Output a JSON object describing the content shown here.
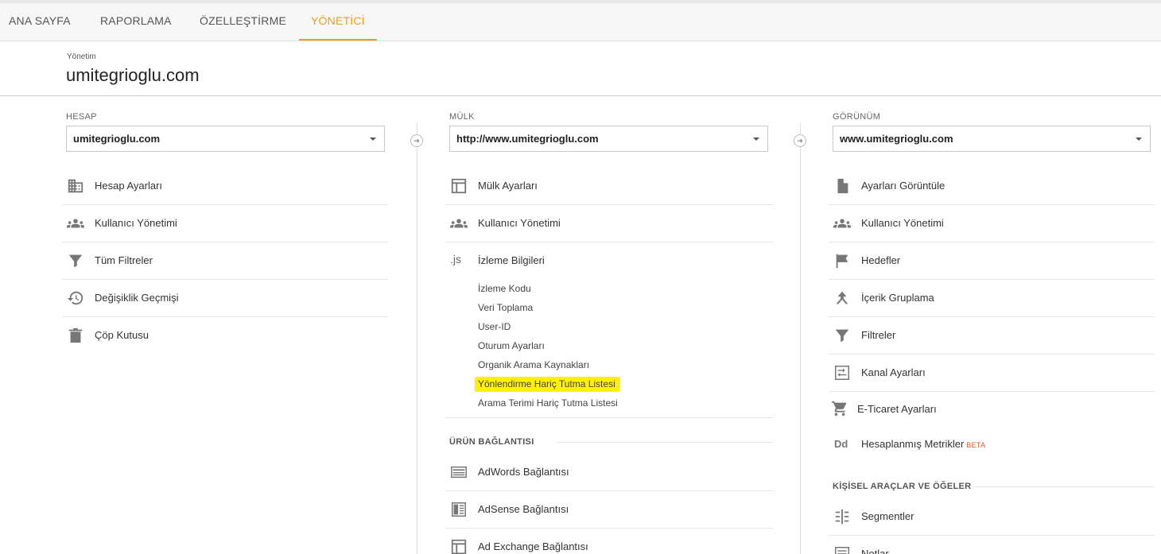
{
  "nav": {
    "tabs": [
      {
        "label": "ANA SAYFA"
      },
      {
        "label": "RAPORLAMA"
      },
      {
        "label": "ÖZELLEŞTİRME"
      },
      {
        "label": "YÖNETİCİ"
      }
    ],
    "active_color": "#f39c12"
  },
  "header": {
    "breadcrumb": "Yönetim",
    "title": "umitegrioglu.com"
  },
  "account": {
    "label": "HESAP",
    "selected": "umitegrioglu.com",
    "items": [
      {
        "label": "Hesap Ayarları",
        "icon": "building-icon"
      },
      {
        "label": "Kullanıcı Yönetimi",
        "icon": "users-icon"
      },
      {
        "label": "Tüm Filtreler",
        "icon": "filter-icon"
      },
      {
        "label": "Değişiklik Geçmişi",
        "icon": "history-icon"
      },
      {
        "label": "Çöp Kutusu",
        "icon": "trash-icon"
      }
    ]
  },
  "property": {
    "label": "MÜLK",
    "selected": "http://www.umitegrioglu.com",
    "items": [
      {
        "label": "Mülk Ayarları",
        "icon": "window-icon"
      },
      {
        "label": "Kullanıcı Yönetimi",
        "icon": "users-icon"
      },
      {
        "label": "İzleme Bilgileri",
        "icon": "js-icon",
        "icon_text": ".js"
      }
    ],
    "tracking_sub": [
      "İzleme Kodu",
      "Veri Toplama",
      "User-ID",
      "Oturum Ayarları",
      "Organik Arama Kaynakları",
      "Yönlendirme Hariç Tutma Listesi",
      "Arama Terimi Hariç Tutma Listesi"
    ],
    "highlight_color": "#fff200",
    "product_links_label": "ÜRÜN BAĞLANTISI",
    "product_links": [
      {
        "label": "AdWords Bağlantısı",
        "icon": "adwords-icon"
      },
      {
        "label": "AdSense Bağlantısı",
        "icon": "adsense-icon"
      },
      {
        "label": "Ad Exchange Bağlantısı",
        "icon": "adexchange-icon"
      }
    ]
  },
  "view": {
    "label": "GÖRÜNÜM",
    "selected": "www.umitegrioglu.com",
    "items": [
      {
        "label": "Ayarları Görüntüle",
        "icon": "document-icon"
      },
      {
        "label": "Kullanıcı Yönetimi",
        "icon": "users-icon"
      },
      {
        "label": "Hedefler",
        "icon": "flag-icon"
      },
      {
        "label": "İçerik Gruplama",
        "icon": "content-grouping-icon"
      },
      {
        "label": "Filtreler",
        "icon": "filter-icon"
      },
      {
        "label": "Kanal Ayarları",
        "icon": "channel-icon"
      },
      {
        "label": "E-Ticaret Ayarları",
        "icon": "cart-icon"
      },
      {
        "label": "Hesaplanmış Metrikler",
        "icon": "dd-icon",
        "icon_text": "Dd",
        "badge": "BETA"
      }
    ],
    "personal_label": "KİŞİSEL ARAÇLAR VE ÖĞELER",
    "personal_items": [
      {
        "label": "Segmentler",
        "icon": "segments-icon"
      },
      {
        "label": "Notlar",
        "icon": "notes-icon"
      }
    ]
  }
}
